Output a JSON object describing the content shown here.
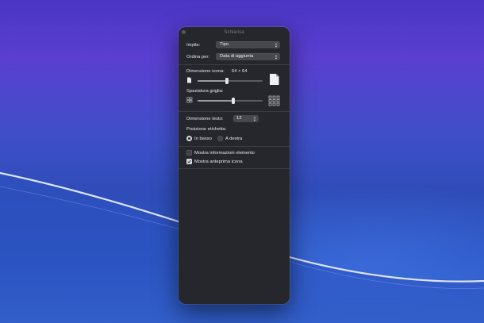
{
  "window": {
    "title": "Schiarisa"
  },
  "settings": {
    "stack_by": {
      "label": "Impila:",
      "value": "Tipo"
    },
    "sort_by": {
      "label": "Ordina per:",
      "value": "Data di aggiunta"
    },
    "icon_size": {
      "label": "Dimensione icona:",
      "value": "64 × 64"
    },
    "grid_spacing": {
      "label": "Spaziatura griglia:"
    },
    "text_size": {
      "label": "Dimensione testo:",
      "value": "12"
    },
    "label_position": {
      "label": "Posizione etichetta:",
      "options": [
        {
          "label": "In basso",
          "selected": true
        },
        {
          "label": "A destra",
          "selected": false
        }
      ]
    },
    "show_item_info": {
      "label": "Mostra informazioni elemento",
      "checked": false
    },
    "show_icon_preview": {
      "label": "Mostra anteprima icona",
      "checked": true
    }
  },
  "sliders": {
    "icon_size_level": 0.45,
    "grid_spacing_level": 0.55
  },
  "colors": {
    "panel": "#25272d",
    "control": "#46484e",
    "accent": "#d7d8dc"
  }
}
